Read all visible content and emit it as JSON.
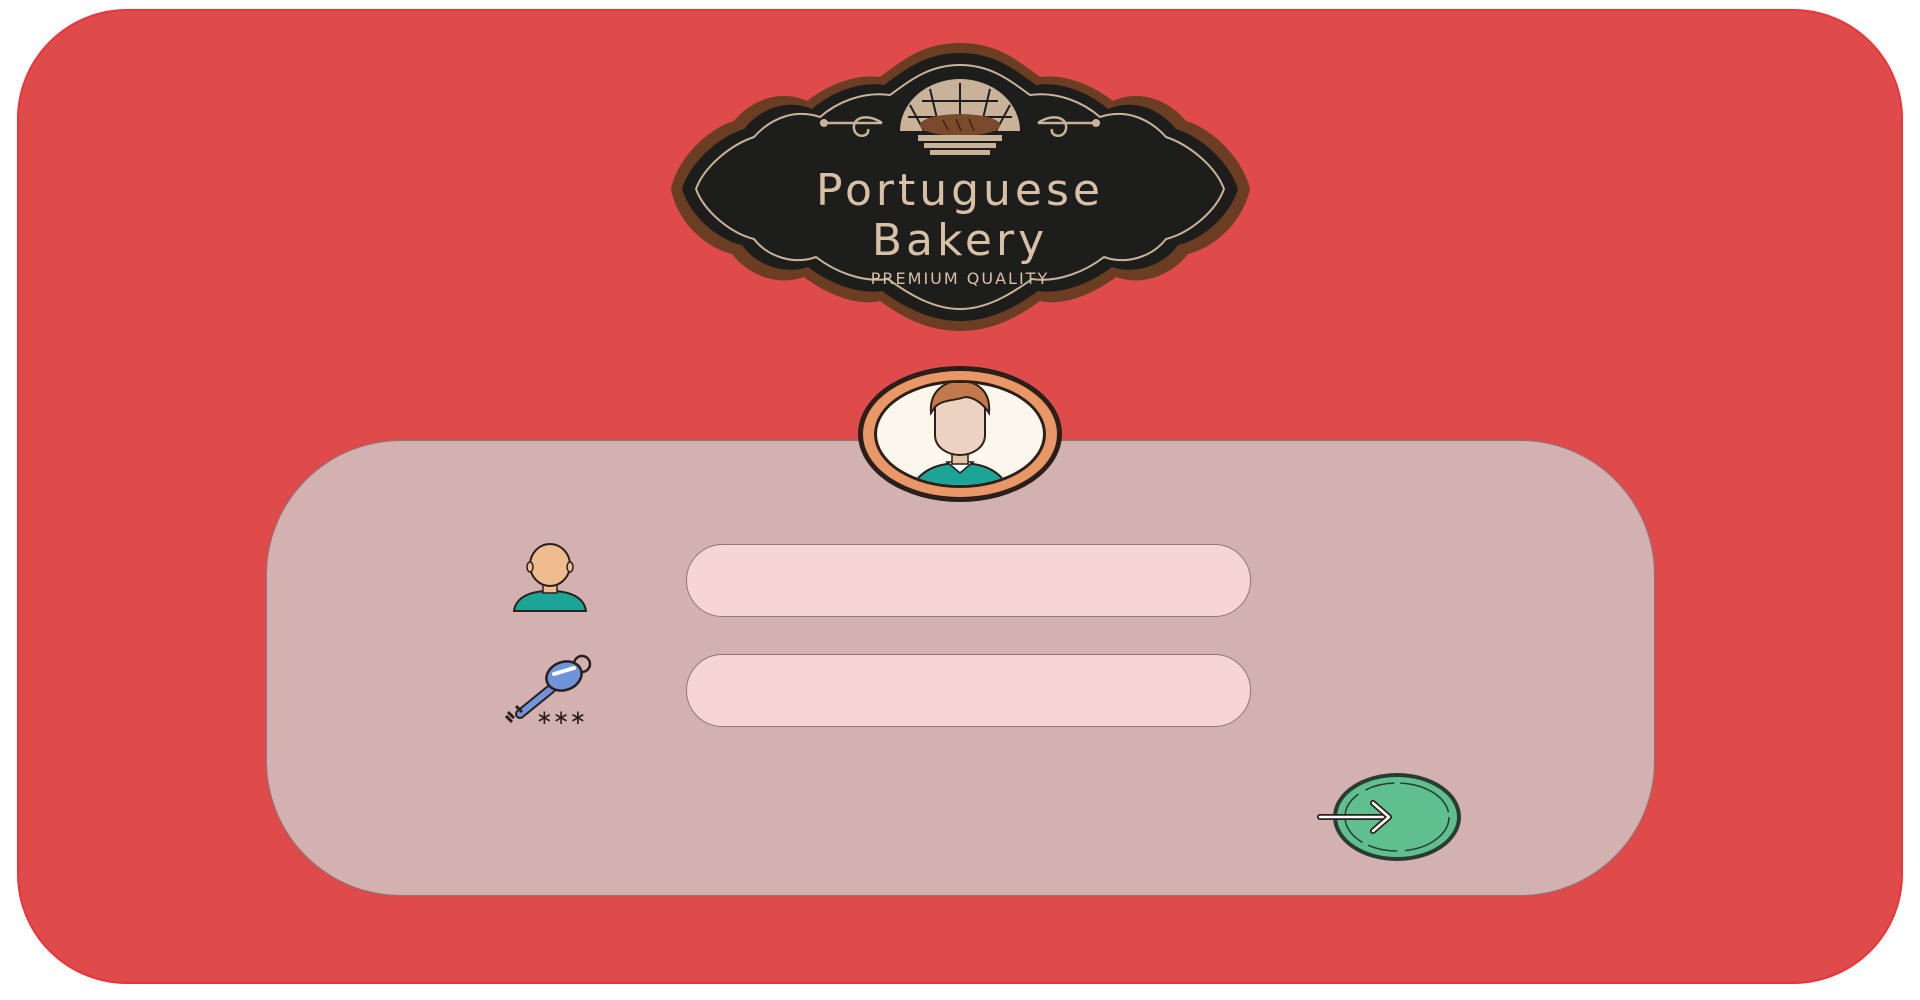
{
  "logo": {
    "line1": "Portuguese",
    "line2": "Bakery",
    "tagline": "PREMIUM QUALITY"
  },
  "form": {
    "username": {
      "value": "",
      "placeholder": ""
    },
    "password": {
      "value": "",
      "placeholder": "",
      "mask_glyphs": "∗∗∗"
    }
  },
  "icons": {
    "logo": "bakery-logo-badge",
    "avatar": "user-avatar-icon",
    "username": "user-icon",
    "password": "key-icon",
    "submit": "arrow-right-icon"
  },
  "colors": {
    "background": "#df4b4b",
    "card": "#d4b1b1",
    "field": "#f8d5d5",
    "submit": "#5fbf8e",
    "logo_badge": "#1d1d1b",
    "logo_text": "#d8c0a6"
  }
}
